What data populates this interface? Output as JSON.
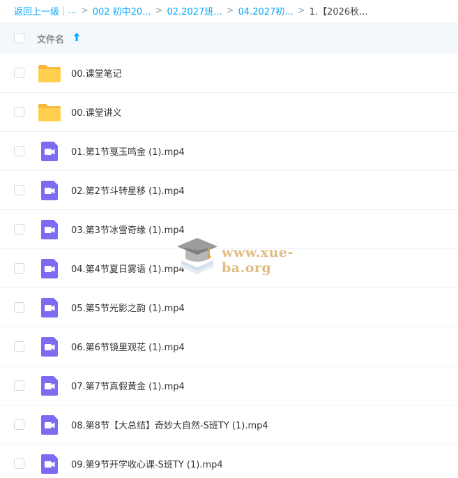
{
  "breadcrumb": {
    "back_label": "返回上一级",
    "pipe": "|",
    "ellipsis": "...",
    "sep": ">",
    "crumb1": "002 初中20...",
    "crumb2": "02.2027班...",
    "crumb3": "04.2027初...",
    "current": "1.【2026秋..."
  },
  "header": {
    "column_label": "文件名"
  },
  "files": [
    {
      "name": "00.课堂笔记",
      "type": "folder"
    },
    {
      "name": "00.课堂讲义",
      "type": "folder"
    },
    {
      "name": "01.第1节戛玉鸣金 (1).mp4",
      "type": "video"
    },
    {
      "name": "02.第2节斗转星移 (1).mp4",
      "type": "video"
    },
    {
      "name": "03.第3节冰雪奇缘 (1).mp4",
      "type": "video"
    },
    {
      "name": "04.第4节夏日雾语 (1).mp4",
      "type": "video"
    },
    {
      "name": "05.第5节光影之韵 (1).mp4",
      "type": "video"
    },
    {
      "name": "06.第6节镜里观花 (1).mp4",
      "type": "video"
    },
    {
      "name": "07.第7节真假黄金 (1).mp4",
      "type": "video"
    },
    {
      "name": "08.第8节【大总结】奇妙大自然-S班TY (1).mp4",
      "type": "video"
    },
    {
      "name": "09.第9节开学收心课-S班TY (1).mp4",
      "type": "video"
    }
  ],
  "watermark": {
    "text": "www.xue-ba.org"
  },
  "colors": {
    "accent": "#06a7ff",
    "folder": "#ffcf4d",
    "video": "#7c6cf2",
    "header_bg": "#f3f8fd"
  }
}
